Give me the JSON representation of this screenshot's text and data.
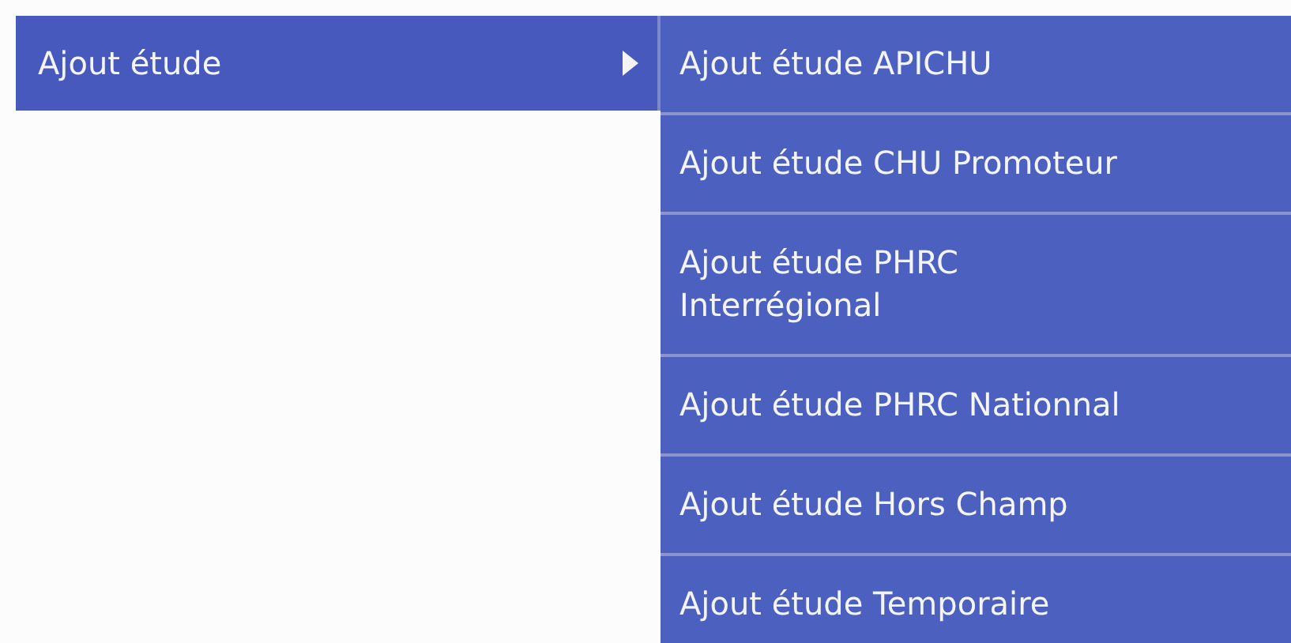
{
  "menu": {
    "label": "Ajout étude",
    "expanded": true,
    "submenu": [
      {
        "label": "Ajout étude APICHU"
      },
      {
        "label": "Ajout étude CHU Promoteur"
      },
      {
        "label": "Ajout étude PHRC Interrégional"
      },
      {
        "label": "Ajout étude PHRC Nationnal"
      },
      {
        "label": "Ajout étude Hors Champ"
      },
      {
        "label": "Ajout étude Temporaire"
      }
    ]
  }
}
